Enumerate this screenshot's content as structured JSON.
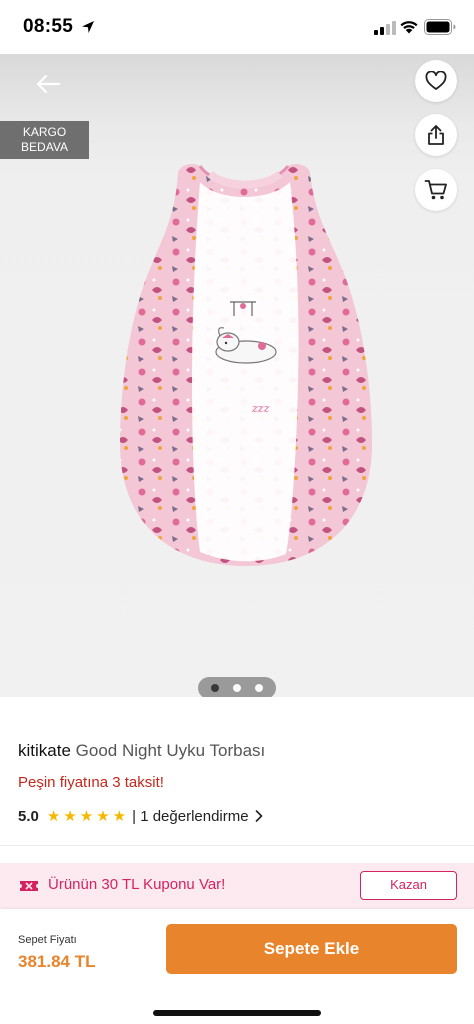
{
  "status_bar": {
    "time": "08:55",
    "icons": [
      "location-arrow-icon",
      "cellular-signal-icon",
      "wifi-icon",
      "battery-icon"
    ]
  },
  "hero": {
    "badge_line1": "KARGO",
    "badge_line2": "BEDAVA",
    "actions": [
      "back-arrow-icon",
      "heart-icon",
      "share-icon",
      "cart-icon"
    ],
    "carousel": {
      "count": 3,
      "active": 1
    },
    "image": "pink sleeping bag with animal print"
  },
  "product": {
    "brand": "kitikate",
    "name": "Good Night Uyku Torbası",
    "installment": "Peşin fiyatına 3 taksit!",
    "rating": "5.0",
    "stars": 5,
    "reviews": "| 1 değerlendirme"
  },
  "coupon": {
    "text": "Ürünün 30 TL Kuponu Var!",
    "button": "Kazan"
  },
  "cart_bar": {
    "price_label": "Sepet Fiyatı",
    "price": "381.84 TL",
    "button": "Sepete Ekle"
  },
  "colors": {
    "accent": "#e8842c",
    "coupon_pink": "#d4245f",
    "installment_red": "#c4271c",
    "star": "#f5b800"
  }
}
